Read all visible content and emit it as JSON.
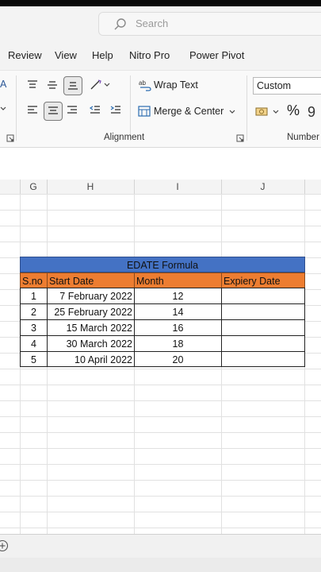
{
  "search": {
    "placeholder": "Search"
  },
  "menu": {
    "items": [
      "Review",
      "View",
      "Help",
      "Nitro Pro",
      "Power Pivot"
    ]
  },
  "ribbon": {
    "wrap_text": "Wrap Text",
    "merge_center": "Merge & Center",
    "alignment_label": "Alignment",
    "number_format_value": "Custom",
    "number_label": "Number",
    "percent_symbol": "%",
    "fragment_a": "A"
  },
  "columns": [
    "G",
    "H",
    "I",
    "J"
  ],
  "table": {
    "title": "EDATE Formula",
    "headers": [
      "S.no",
      "Start Date",
      "Month",
      "Expiery Date"
    ],
    "rows": [
      {
        "sno": "1",
        "start": "7 February 2022",
        "month": "12",
        "expiry": ""
      },
      {
        "sno": "2",
        "start": "25 February 2022",
        "month": "14",
        "expiry": ""
      },
      {
        "sno": "3",
        "start": "15 March 2022",
        "month": "16",
        "expiry": ""
      },
      {
        "sno": "4",
        "start": "30 March 2022",
        "month": "18",
        "expiry": ""
      },
      {
        "sno": "5",
        "start": "10 April 2022",
        "month": "20",
        "expiry": ""
      }
    ]
  },
  "colors": {
    "title_fill": "#4472c4",
    "header_fill": "#ed7d31"
  }
}
